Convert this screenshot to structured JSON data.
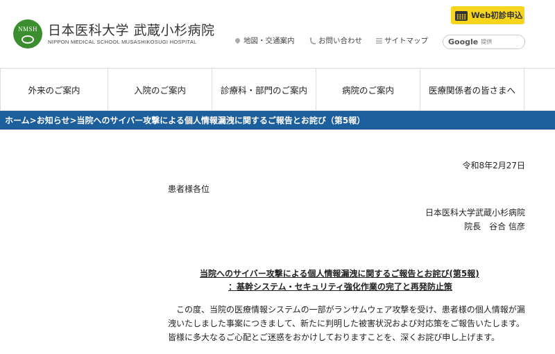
{
  "header": {
    "logo_jp": "日本医科大学 武蔵小杉病院",
    "logo_en": "NIPPON MEDICAL SCHOOL MUSASHIKOSUGI HOSPITAL",
    "logo_mark_text": "NMSH",
    "web_button": "Web初診申込",
    "links": {
      "map": "地図・交通案内",
      "contact": "お問い合わせ",
      "sitemap": "サイトマップ"
    },
    "search": {
      "brand": "Google",
      "provided": "提供"
    }
  },
  "nav": {
    "items": [
      {
        "label": "外来のご案内"
      },
      {
        "label": "入院のご案内"
      },
      {
        "label": "診療科・部門のご案内"
      },
      {
        "label": "病院のご案内"
      },
      {
        "label": "医療関係者の皆さまへ"
      }
    ]
  },
  "breadcrumb": {
    "text": "ホーム>お知らせ>当院へのサイバー攻撃による個人情報漏洩に関するご報告とお詫び（第5報）"
  },
  "letter": {
    "date": "令和8年2月27日",
    "addressee": "患者様各位",
    "sender_org": "日本医科大学武蔵小杉病院",
    "sender_name": "院長　谷合 信彦",
    "title_line1": "当院へのサイバー攻撃による個人情報漏洩に関するご報告とお詫び(第5報)",
    "title_line2": "：基幹システム・セキュリティ強化作業の完了と再発防止策",
    "body": "　この度、当院の医療情報システムの一部がランサムウェア攻撃を受け、患者様の個人情報が漏洩いたしました事案につきまして、新たに判明した被害状況および対応策をご報告いたします。皆様に多大なるご心配とご迷惑をおかけしておりますことを、深くお詫び申し上げます。"
  },
  "colors": {
    "brand_green": "#3c8d2f",
    "breadcrumb_blue": "#1d5e9c",
    "web_button_yellow": "#f6d51c"
  },
  "icons": [
    "logo-mark",
    "calendar-icon",
    "map-pin-icon",
    "phone-icon",
    "list-icon"
  ]
}
